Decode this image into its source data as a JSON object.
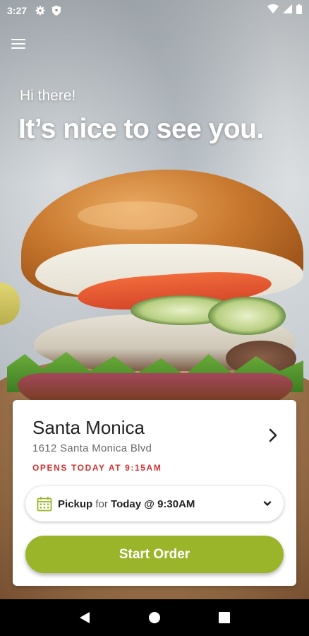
{
  "status_bar": {
    "time": "3:27",
    "icons": [
      "gear-icon",
      "shield-icon",
      "wifi-icon",
      "signal-icon",
      "battery-icon"
    ]
  },
  "header": {
    "menu_icon": "hamburger-menu-icon",
    "greeting": "Hi there!",
    "headline": "It’s nice to see you."
  },
  "location": {
    "name": "Santa Monica",
    "address": "1612 Santa Monica Blvd",
    "status": "OPENS TODAY AT 9:15AM",
    "status_color": "#d32f2f"
  },
  "pickup": {
    "mode": "Pickup",
    "for_label": "for",
    "time": "Today @ 9:30AM",
    "icon": "calendar-icon",
    "accent": "#9bb52a"
  },
  "actions": {
    "start_order_label": "Start Order",
    "accent": "#9bb52a"
  },
  "nav_bar": {
    "buttons": [
      "back-icon",
      "home-icon",
      "recents-icon"
    ]
  }
}
